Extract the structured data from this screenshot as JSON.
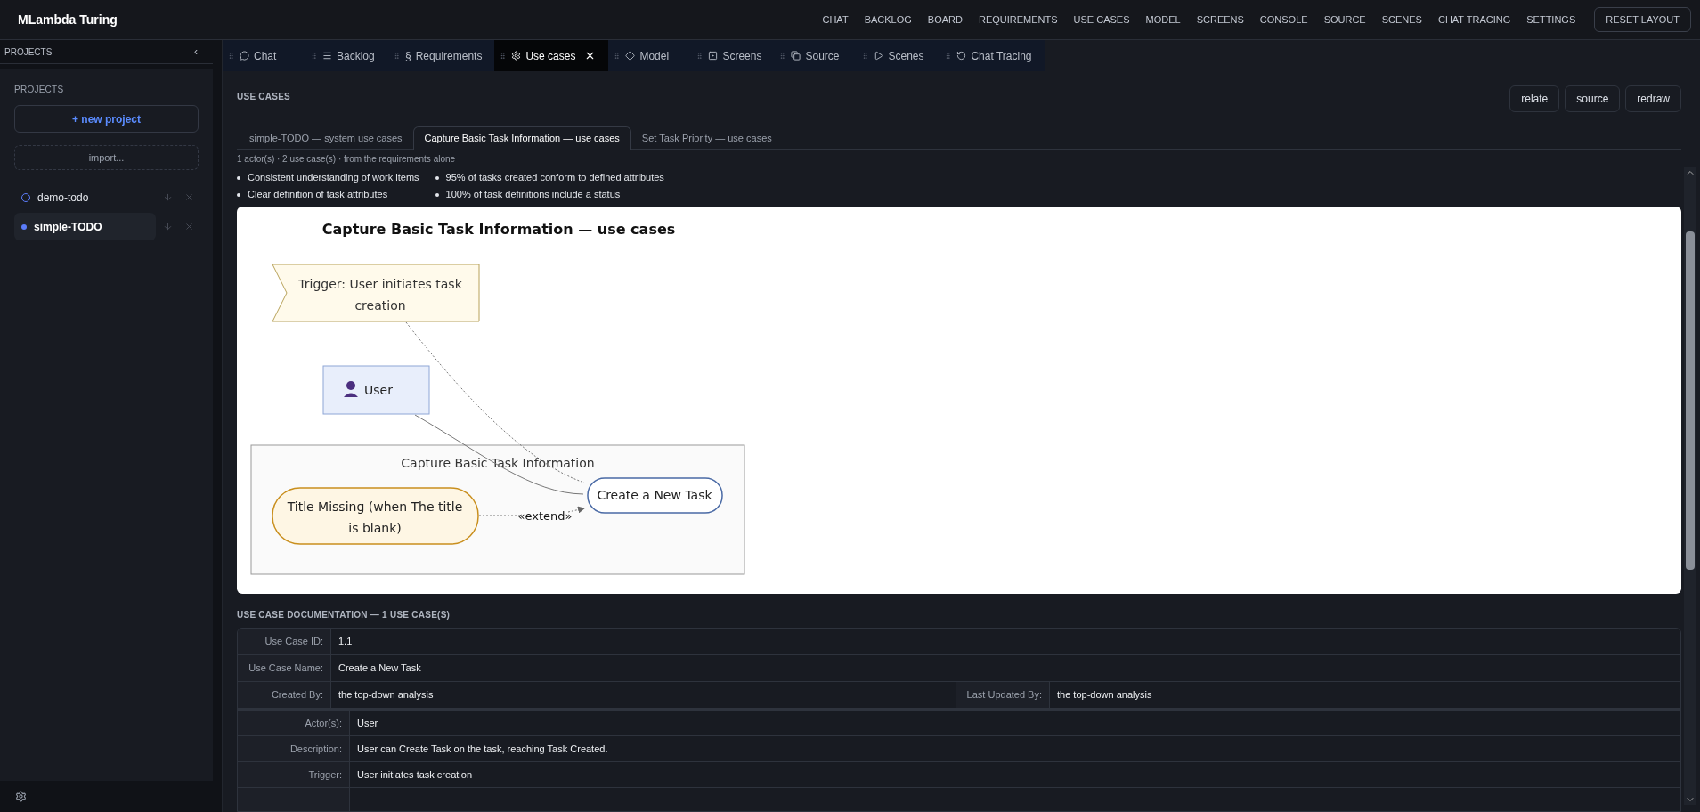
{
  "app": {
    "title": "MLambda Turing"
  },
  "nav": [
    "CHAT",
    "BACKLOG",
    "BOARD",
    "REQUIREMENTS",
    "USE CASES",
    "MODEL",
    "SCREENS",
    "CONSOLE",
    "SOURCE",
    "SCENES",
    "CHAT TRACING",
    "SETTINGS"
  ],
  "reset_button": "RESET LAYOUT",
  "sidebar": {
    "header": "PROJECTS",
    "collapse": "‹",
    "section_title": "PROJECTS",
    "new_project": "+ new project",
    "import": "import...",
    "projects": [
      {
        "name": "demo-todo",
        "selected": false
      },
      {
        "name": "simple-TODO",
        "selected": true
      }
    ]
  },
  "dock_tabs": [
    {
      "label": "Chat",
      "selected": false
    },
    {
      "label": "Backlog",
      "selected": false
    },
    {
      "label": "Requirements",
      "glyph": "§",
      "selected": false
    },
    {
      "label": "Use cases",
      "selected": true
    },
    {
      "label": "Model",
      "selected": false
    },
    {
      "label": "Screens",
      "selected": false
    },
    {
      "label": "Source",
      "selected": false
    },
    {
      "label": "Scenes",
      "selected": false
    },
    {
      "label": "Chat Tracing",
      "selected": false
    }
  ],
  "content": {
    "title": "USE CASES",
    "actions": [
      "relate",
      "source",
      "redraw"
    ],
    "subtabs": [
      {
        "label": "simple-TODO — system use cases",
        "selected": false
      },
      {
        "label": "Capture Basic Task Information — use cases",
        "selected": true
      },
      {
        "label": "Set Task Priority — use cases",
        "selected": false
      }
    ],
    "summary": "1 actor(s) · 2 use case(s) · from the requirements alone",
    "bullets_left": [
      "Consistent understanding of work items",
      "Clear definition of task attributes"
    ],
    "bullets_right": [
      "95% of tasks created conform to defined attributes",
      "100% of task definitions include a status"
    ]
  },
  "diagram": {
    "title": "Capture Basic Task Information — use cases",
    "trigger": "Trigger: User initiates task creation",
    "actor": "User",
    "boundary": "Capture Basic Task Information",
    "extension": "Title Missing (when The title is blank)",
    "use_case": "Create a New Task",
    "extend_label": "«extend»"
  },
  "documentation": {
    "title": "USE CASE DOCUMENTATION — 1 USE CASE(S)",
    "header_rows": [
      {
        "label": "Use Case ID:",
        "value": "1.1"
      },
      {
        "label": "Use Case Name:",
        "value": "Create a New Task"
      },
      {
        "label": "Created By:",
        "value": "the top-down analysis",
        "label_2": "Last Updated By:",
        "value_2": "the top-down analysis"
      }
    ],
    "rows": [
      {
        "label": "Actor(s):",
        "value": "User"
      },
      {
        "label": "Description:",
        "value": "User can Create Task on the task, reaching Task Created."
      },
      {
        "label": "Trigger:",
        "value": "User initiates task creation"
      }
    ]
  }
}
